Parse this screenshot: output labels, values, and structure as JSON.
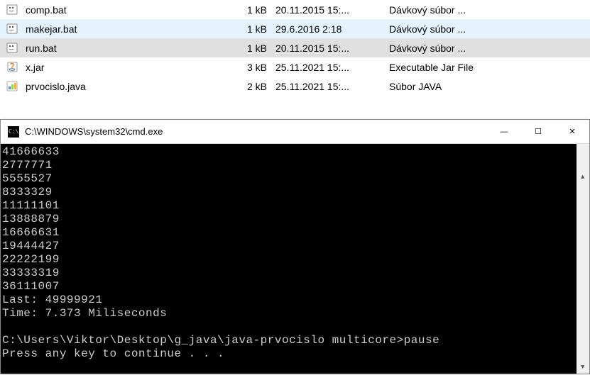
{
  "files": [
    {
      "name": "comp.bat",
      "size": "1 kB",
      "date": "20.11.2015 15:...",
      "type": "Dávkový súbor ...",
      "icon": "bat",
      "row": ""
    },
    {
      "name": "makejar.bat",
      "size": "1 kB",
      "date": "29.6.2016 2:18",
      "type": "Dávkový súbor ...",
      "icon": "bat",
      "row": "highlight-blue"
    },
    {
      "name": "run.bat",
      "size": "1 kB",
      "date": "20.11.2015 15:...",
      "type": "Dávkový súbor ...",
      "icon": "bat",
      "row": "highlight-gray"
    },
    {
      "name": "x.jar",
      "size": "3 kB",
      "date": "25.11.2021 15:...",
      "type": "Executable Jar File",
      "icon": "jar",
      "row": ""
    },
    {
      "name": "prvocislo.java",
      "size": "2 kB",
      "date": "25.11.2021 15:...",
      "type": "Súbor JAVA",
      "icon": "java",
      "row": ""
    }
  ],
  "cmd": {
    "title": "C:\\WINDOWS\\system32\\cmd.exe",
    "win": {
      "min": "—",
      "max": "☐",
      "close": "✕"
    },
    "output": "41666633\n2777771\n5555527\n8333329\n11111101\n13888879\n16666631\n19444427\n22222199\n33333319\n36111007\nLast: 49999921\nTime: 7.373 Miliseconds\n\nC:\\Users\\Viktor\\Desktop\\g_java\\java-prvocislo multicore>pause\nPress any key to continue . . .",
    "scroll": {
      "up": "▲",
      "down": "▼"
    }
  }
}
